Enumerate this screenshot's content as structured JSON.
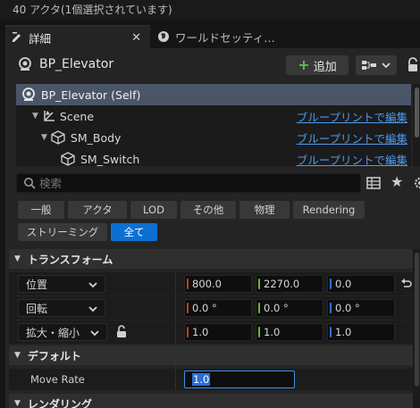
{
  "status_bar": {
    "text": "40 アクタ(1個選択されています)"
  },
  "tabs": [
    {
      "label": "詳細",
      "active": true,
      "close": "✕"
    },
    {
      "label": "ワールドセッティ…",
      "active": false
    }
  ],
  "header": {
    "actor_name": "BP_Elevator",
    "add_button_label": "追加"
  },
  "component_tree": [
    {
      "label": "BP_Elevator (Self)",
      "link": ""
    },
    {
      "label": "Scene",
      "link": "ブループリントで編集"
    },
    {
      "label": "SM_Body",
      "link": "ブループリントで編集"
    },
    {
      "label": "SM_Switch",
      "link": "ブループリントで編集"
    }
  ],
  "search": {
    "placeholder": "検索"
  },
  "filters": [
    {
      "label": "一般",
      "active": false
    },
    {
      "label": "アクタ",
      "active": false
    },
    {
      "label": "LOD",
      "active": false
    },
    {
      "label": "その他",
      "active": false
    },
    {
      "label": "物理",
      "active": false
    },
    {
      "label": "Rendering",
      "active": false
    },
    {
      "label": "ストリーミング",
      "active": false
    },
    {
      "label": "全て",
      "active": true
    }
  ],
  "sections": {
    "transform": "トランスフォーム",
    "default": "デフォルト",
    "rendering": "レンダリング"
  },
  "transform": {
    "location": {
      "label": "位置",
      "x": "800.0",
      "y": "2270.0",
      "z": "0.0"
    },
    "rotation": {
      "label": "回転",
      "x": "0.0 °",
      "y": "0.0 °",
      "z": "0.0 °"
    },
    "scale": {
      "label": "拡大・縮小",
      "x": "1.0",
      "y": "1.0",
      "z": "1.0"
    }
  },
  "default_props": {
    "move_rate": {
      "label": "Move Rate",
      "value": "1.0"
    }
  },
  "colors": {
    "accent": "#0e6fd3",
    "link": "#4e9af0",
    "selected_row": "#4a5567",
    "axis_x": "#c9362b",
    "axis_y": "#6fb42c",
    "axis_z": "#2d75d6"
  }
}
